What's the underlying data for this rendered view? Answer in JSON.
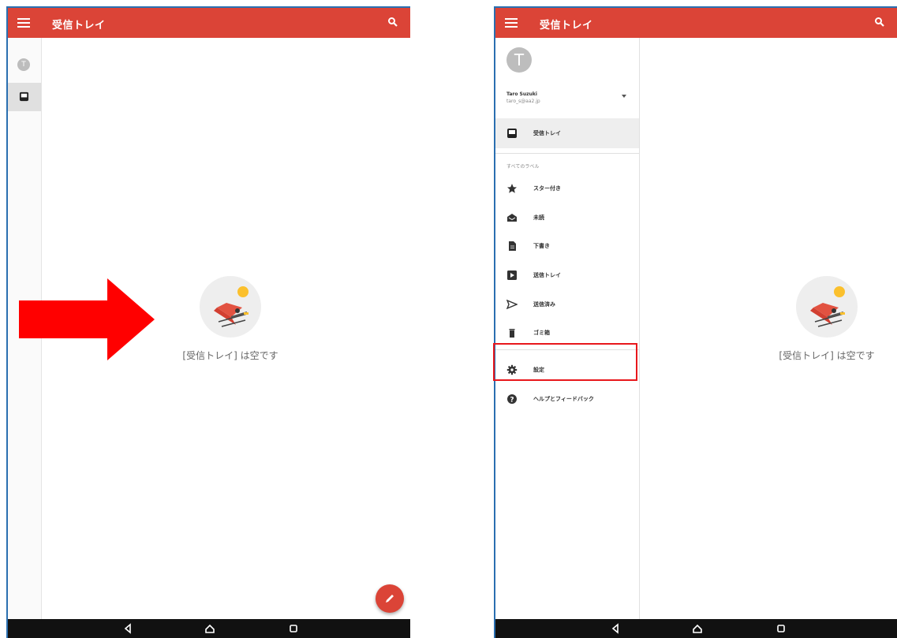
{
  "app": {
    "title": "受信トレイ"
  },
  "empty_message": "[受信トレイ] は空です",
  "left_screen": {
    "rail_avatar_initial": "T"
  },
  "drawer": {
    "avatar_initial": "T",
    "account_name": "Taro Suzuki",
    "account_email": "taro_s@aa2.jp",
    "inbox_label": "受信トレイ",
    "section_label": "すべてのラベル",
    "items": [
      {
        "label": "スター付き",
        "icon": "star-icon"
      },
      {
        "label": "未読",
        "icon": "open-envelope-icon"
      },
      {
        "label": "下書き",
        "icon": "draft-document-icon"
      },
      {
        "label": "送信トレイ",
        "icon": "outbox-icon"
      },
      {
        "label": "送信済み",
        "icon": "send-icon"
      },
      {
        "label": "ゴミ箱",
        "icon": "trash-icon"
      },
      {
        "label": "設定",
        "icon": "gear-icon"
      },
      {
        "label": "ヘルプとフィードバック",
        "icon": "help-icon"
      }
    ]
  },
  "colors": {
    "appbar": "#db4437",
    "highlight": "#e8171c",
    "arrow": "#ff0000",
    "navbar": "#111111"
  }
}
